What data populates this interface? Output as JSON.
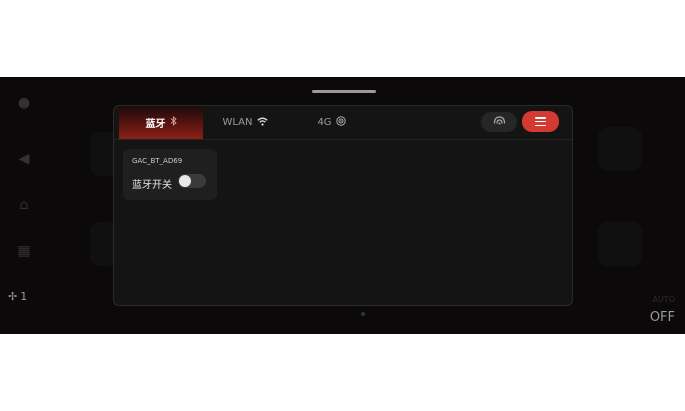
{
  "background": {
    "fan_level": "1",
    "climate_auto": "AUTO",
    "climate_state": "OFF"
  },
  "tabs": [
    {
      "label": "蓝牙",
      "icon": "bluetooth-icon",
      "active": true
    },
    {
      "label": "WLAN",
      "icon": "wifi-icon",
      "active": false
    },
    {
      "label": "4G",
      "icon": "cellular-icon",
      "active": false
    }
  ],
  "bluetooth": {
    "device_name": "GAC_BT_AD69",
    "switch_label": "蓝牙开关",
    "switch_on": false
  },
  "colors": {
    "accent": "#d23a32",
    "panel": "#141414",
    "screen": "#0b0909"
  }
}
